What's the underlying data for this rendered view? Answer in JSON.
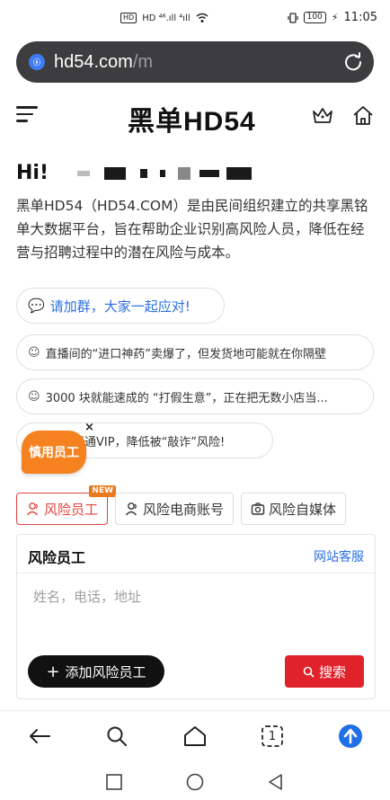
{
  "status_bar": {
    "left_indicators": "HD ⁴⁶.ıll ⁴ıll",
    "battery": "100",
    "time": "11:05"
  },
  "url_bar": {
    "domain": "hd54.com",
    "path": "/m",
    "site_icon": "browser-site-icon",
    "reload_icon": "reload-icon"
  },
  "header": {
    "logo": "黑单HD54",
    "menu_icon": "hamburger-menu-icon",
    "crown_icon": "crown-icon",
    "home_icon": "home-icon"
  },
  "greeting": {
    "hi": "Hi!"
  },
  "description": "黑单HD54（HD54.COM）是由民间组织建立的共享黑铭单大数据平台，旨在帮助企业识别高风险人员，降低在经营与招聘过程中的潜在风险与成本。",
  "pills": [
    {
      "text": "请加群，大家一起应对!"
    },
    {
      "text": "直播间的“进口神药”卖爆了，但发货地可能就在你隔壁"
    },
    {
      "text": "3000 块就能速成的 “打假生意”，正在把无数小店当..."
    },
    {
      "text": "开通VIP，降低被“敲诈”风险!"
    }
  ],
  "floating_badge": {
    "label": "慎用员工",
    "close": "×"
  },
  "tabs": [
    {
      "label": "风险员工",
      "badge": "NEW",
      "active": true
    },
    {
      "label": "风险电商账号",
      "active": false
    },
    {
      "label": "风险自媒体",
      "active": false
    }
  ],
  "card": {
    "title": "风险员工",
    "link": "网站客服",
    "input_placeholder": "姓名，电话，地址",
    "add_button": "添加风险员工",
    "search_button": "搜索"
  },
  "browser_nav": {
    "tab_count": "1"
  },
  "colors": {
    "accent_red": "#e0222b",
    "tab_red": "#e0453f",
    "link_blue": "#2c6fe0",
    "badge_orange": "#f5821f",
    "url_bar_bg": "#3d3d3f"
  }
}
